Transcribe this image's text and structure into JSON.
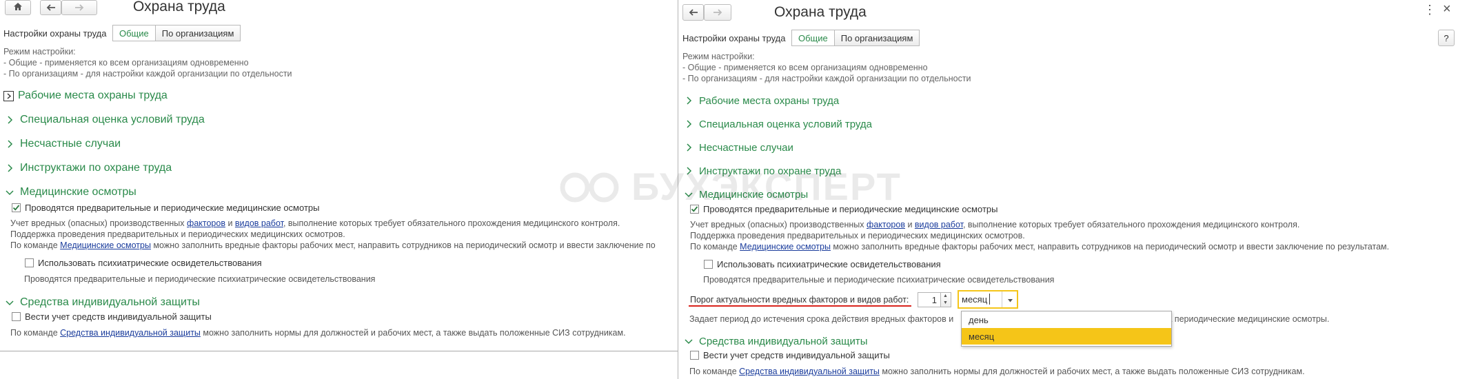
{
  "left": {
    "title": "Охрана труда",
    "settings_label": "Настройки охраны труда",
    "tabs": [
      "Общие",
      "По организациям"
    ],
    "mode_note": [
      "Режим настройки:",
      "- Общие - применяется ко всем организациям одновременно",
      "- По организациям - для настройки каждой организации по отдельности"
    ],
    "sections": [
      "Рабочие места охраны труда",
      "Специальная оценка условий труда",
      "Несчастные случаи",
      "Инструктажи по охране труда",
      "Медицинские осмотры",
      "Средства индивидуальной защиты"
    ],
    "med": {
      "checkbox1_label": "Проводятся предварительные и периодические медицинские осмотры",
      "desc_line1_a": "Учет вредных (опасных) производственных ",
      "desc_line1_link1": "факторов",
      "desc_line1_b": " и ",
      "desc_line1_link2": "видов работ",
      "desc_line1_c": ", выполнение которых требует обязательного прохождения медицинского контроля.",
      "desc_line2": "Поддержка проведения предварительных и периодических медицинских осмотров.",
      "desc_line3_a": "По команде ",
      "desc_line3_link": "Медицинские осмотры",
      "desc_line3_b": " можно заполнить вредные факторы рабочих мест, направить сотрудников на периодический осмотр и ввести заключение по",
      "checkbox2_label": "Использовать психиатрические освидетельствования",
      "checkbox2_desc": "Проводятся предварительные и периодические психиатрические освидетельствования"
    },
    "siz": {
      "checkbox_label": "Вести учет средств индивидуальной защиты",
      "desc_a": "По команде ",
      "desc_link": "Средства индивидуальной защиты",
      "desc_b": " можно заполнить нормы для должностей и рабочих мест, а также выдать положенные СИЗ сотрудникам."
    }
  },
  "right": {
    "title": "Охрана труда",
    "settings_label": "Настройки охраны труда",
    "tabs": [
      "Общие",
      "По организациям"
    ],
    "help_label": "?",
    "more_label": "⋮",
    "close_label": "×",
    "mode_note": [
      "Режим настройки:",
      "- Общие - применяется ко всем организациям одновременно",
      "- По организациям - для настройки каждой организации по отдельности"
    ],
    "sections": [
      "Рабочие места охраны труда",
      "Специальная оценка условий труда",
      "Несчастные случаи",
      "Инструктажи по охране труда",
      "Медицинские осмотры",
      "Средства индивидуальной защиты"
    ],
    "med": {
      "checkbox1_label": "Проводятся предварительные и периодические медицинские осмотры",
      "desc_line1_a": "Учет вредных (опасных) производственных ",
      "desc_line1_link1": "факторов",
      "desc_line1_b": " и ",
      "desc_line1_link2": "видов работ",
      "desc_line1_c": ", выполнение которых требует обязательного прохождения медицинского контроля.",
      "desc_line2": "Поддержка проведения предварительных и периодических медицинских осмотров.",
      "desc_line3_a": "По команде ",
      "desc_line3_link": "Медицинские осмотры",
      "desc_line3_b": " можно заполнить вредные факторы рабочих мест, направить сотрудников на периодический осмотр и ввести заключение по результатам.",
      "checkbox2_label": "Использовать психиатрические освидетельствования",
      "checkbox2_desc": "Проводятся предварительные и периодические психиатрические освидетельствования",
      "threshold_label": "Порог актуальности вредных факторов и видов работ:",
      "threshold_value": "1",
      "period_value": "месяц",
      "period_options": [
        "день",
        "месяц"
      ],
      "period_desc_a": "Задает период до истечения срока действия вредных факторов и",
      "period_desc_b": "учаются в направлении на периодические медицинские осмотры."
    },
    "siz": {
      "checkbox_label": "Вести учет средств индивидуальной защиты",
      "desc_a": "По команде ",
      "desc_link": "Средства индивидуальной защиты",
      "desc_b": " можно заполнить нормы для должностей и рабочих мест, а также выдать положенные СИЗ сотрудникам."
    }
  },
  "watermark_text": "БУХЭКСПЕРТ",
  "colors": {
    "section_green": "#2a8a4a",
    "link_blue": "#1a3c9c",
    "highlight_yellow": "#f5c518",
    "annotation_red": "#d9241c"
  }
}
